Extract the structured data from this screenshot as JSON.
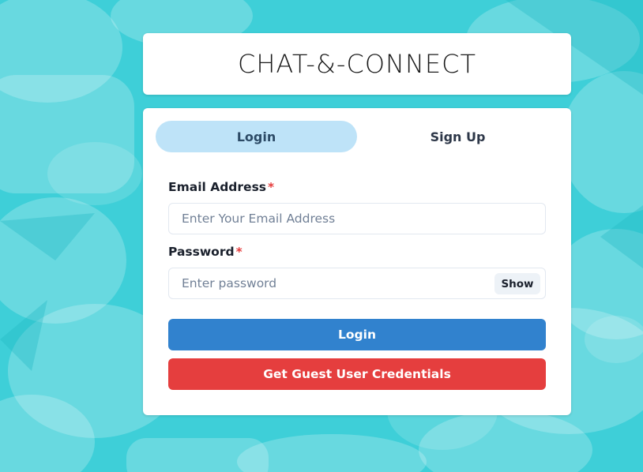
{
  "app": {
    "title": "CHAT-&-CONNECT"
  },
  "tabs": [
    {
      "label": "Login",
      "active": true
    },
    {
      "label": "Sign Up",
      "active": false
    }
  ],
  "form": {
    "email": {
      "label": "Email Address",
      "required_mark": "*",
      "placeholder": "Enter Your Email Address",
      "value": ""
    },
    "password": {
      "label": "Password",
      "required_mark": "*",
      "placeholder": "Enter password",
      "value": "",
      "toggle_label": "Show"
    },
    "login_button": "Login",
    "guest_button": "Get Guest User Credentials"
  },
  "colors": {
    "background": "#3ecfd8",
    "tab_active": "#bee3f8",
    "primary": "#3182ce",
    "danger": "#e53e3e",
    "required": "#e53e3e"
  }
}
